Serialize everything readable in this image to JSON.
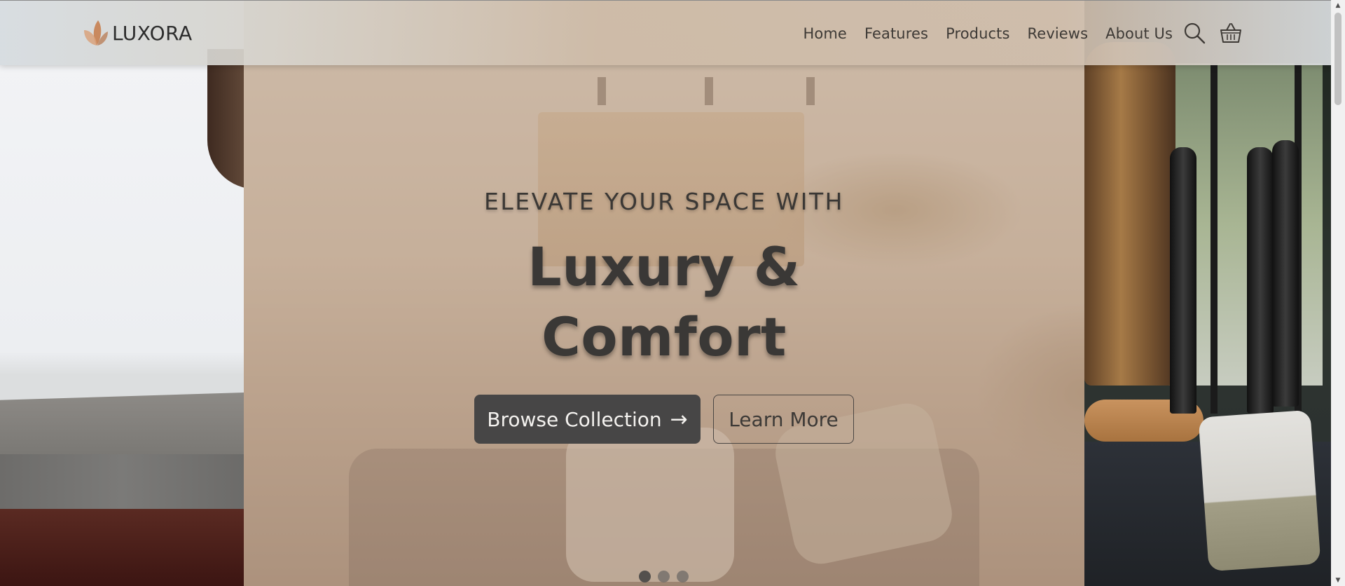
{
  "brand": {
    "name": "LUXORA",
    "accent_color": "#c98a65"
  },
  "nav": {
    "items": [
      {
        "label": "Home"
      },
      {
        "label": "Features"
      },
      {
        "label": "Products"
      },
      {
        "label": "Reviews"
      },
      {
        "label": "About Us"
      }
    ],
    "icons": [
      "search-icon",
      "cart-icon"
    ]
  },
  "hero": {
    "kicker": "ELEVATE YOUR SPACE WITH",
    "headline_line1": "Luxury &",
    "headline_line2": "Comfort",
    "primary_button": "Browse Collection",
    "primary_button_arrow": "→",
    "secondary_button": "Learn More",
    "slides": {
      "count": 3,
      "active_index": 0
    }
  },
  "colors": {
    "button_primary_bg": "#474646",
    "text_dark": "#3a3836"
  }
}
